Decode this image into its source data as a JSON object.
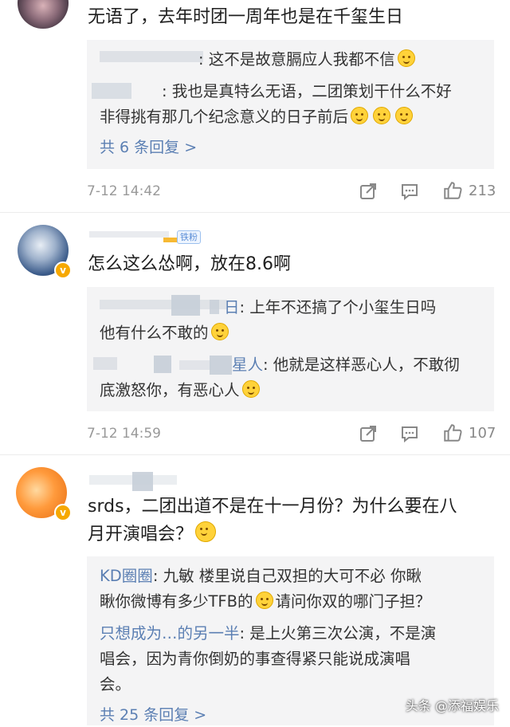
{
  "comments": [
    {
      "content": "无语了，去年时团一周年也是在千玺生日",
      "replies": [
        {
          "name": "…",
          "text": ": 这不是故意膈应人我都不信"
        },
        {
          "name": "…",
          "text": ": 我也是真特么无语，二团策划干什么不好",
          "cont": "非得挑有那几个纪念意义的日子前后"
        }
      ],
      "total": "共 6 条回复 >",
      "time": "7-12 14:42",
      "likes": "213"
    },
    {
      "fan_badge": "铁粉",
      "content": "怎么这么怂啊，放在8.6啊",
      "replies": [
        {
          "name": "日",
          "text": ": 上年不还搞了个小玺生日吗",
          "cont": "他有什么不敢的"
        },
        {
          "name": "星人",
          "text": ": 他就是这样恶心人，不敢彻",
          "cont": "底激怒你，有恶心人"
        }
      ],
      "time": "7-12 14:59",
      "likes": "107"
    },
    {
      "content": "srds，二团出道不是在十一月份？为什么要在八",
      "content_cont": "月开演唱会？",
      "replies": [
        {
          "name": "KD圈圈",
          "text": ": 九敏  楼里说自己双担的大可不必  你瞅",
          "cont": "瞅你微博有多少TFB的",
          "cont2": "请问你双的哪门子担？"
        },
        {
          "name": "只想成为…的另一半",
          "text": ": 是上火第三次公演，不是演",
          "cont": "唱会，因为青你倒奶的事查得紧只能说成演唱",
          "cont2": "会。"
        }
      ],
      "total": "共 25 条回复 >"
    }
  ],
  "watermark": "头条 @添福娱乐",
  "colors": {
    "link": "#5b7fb3",
    "reply_bg": "#f4f4f5",
    "badge": "#f6a800"
  }
}
